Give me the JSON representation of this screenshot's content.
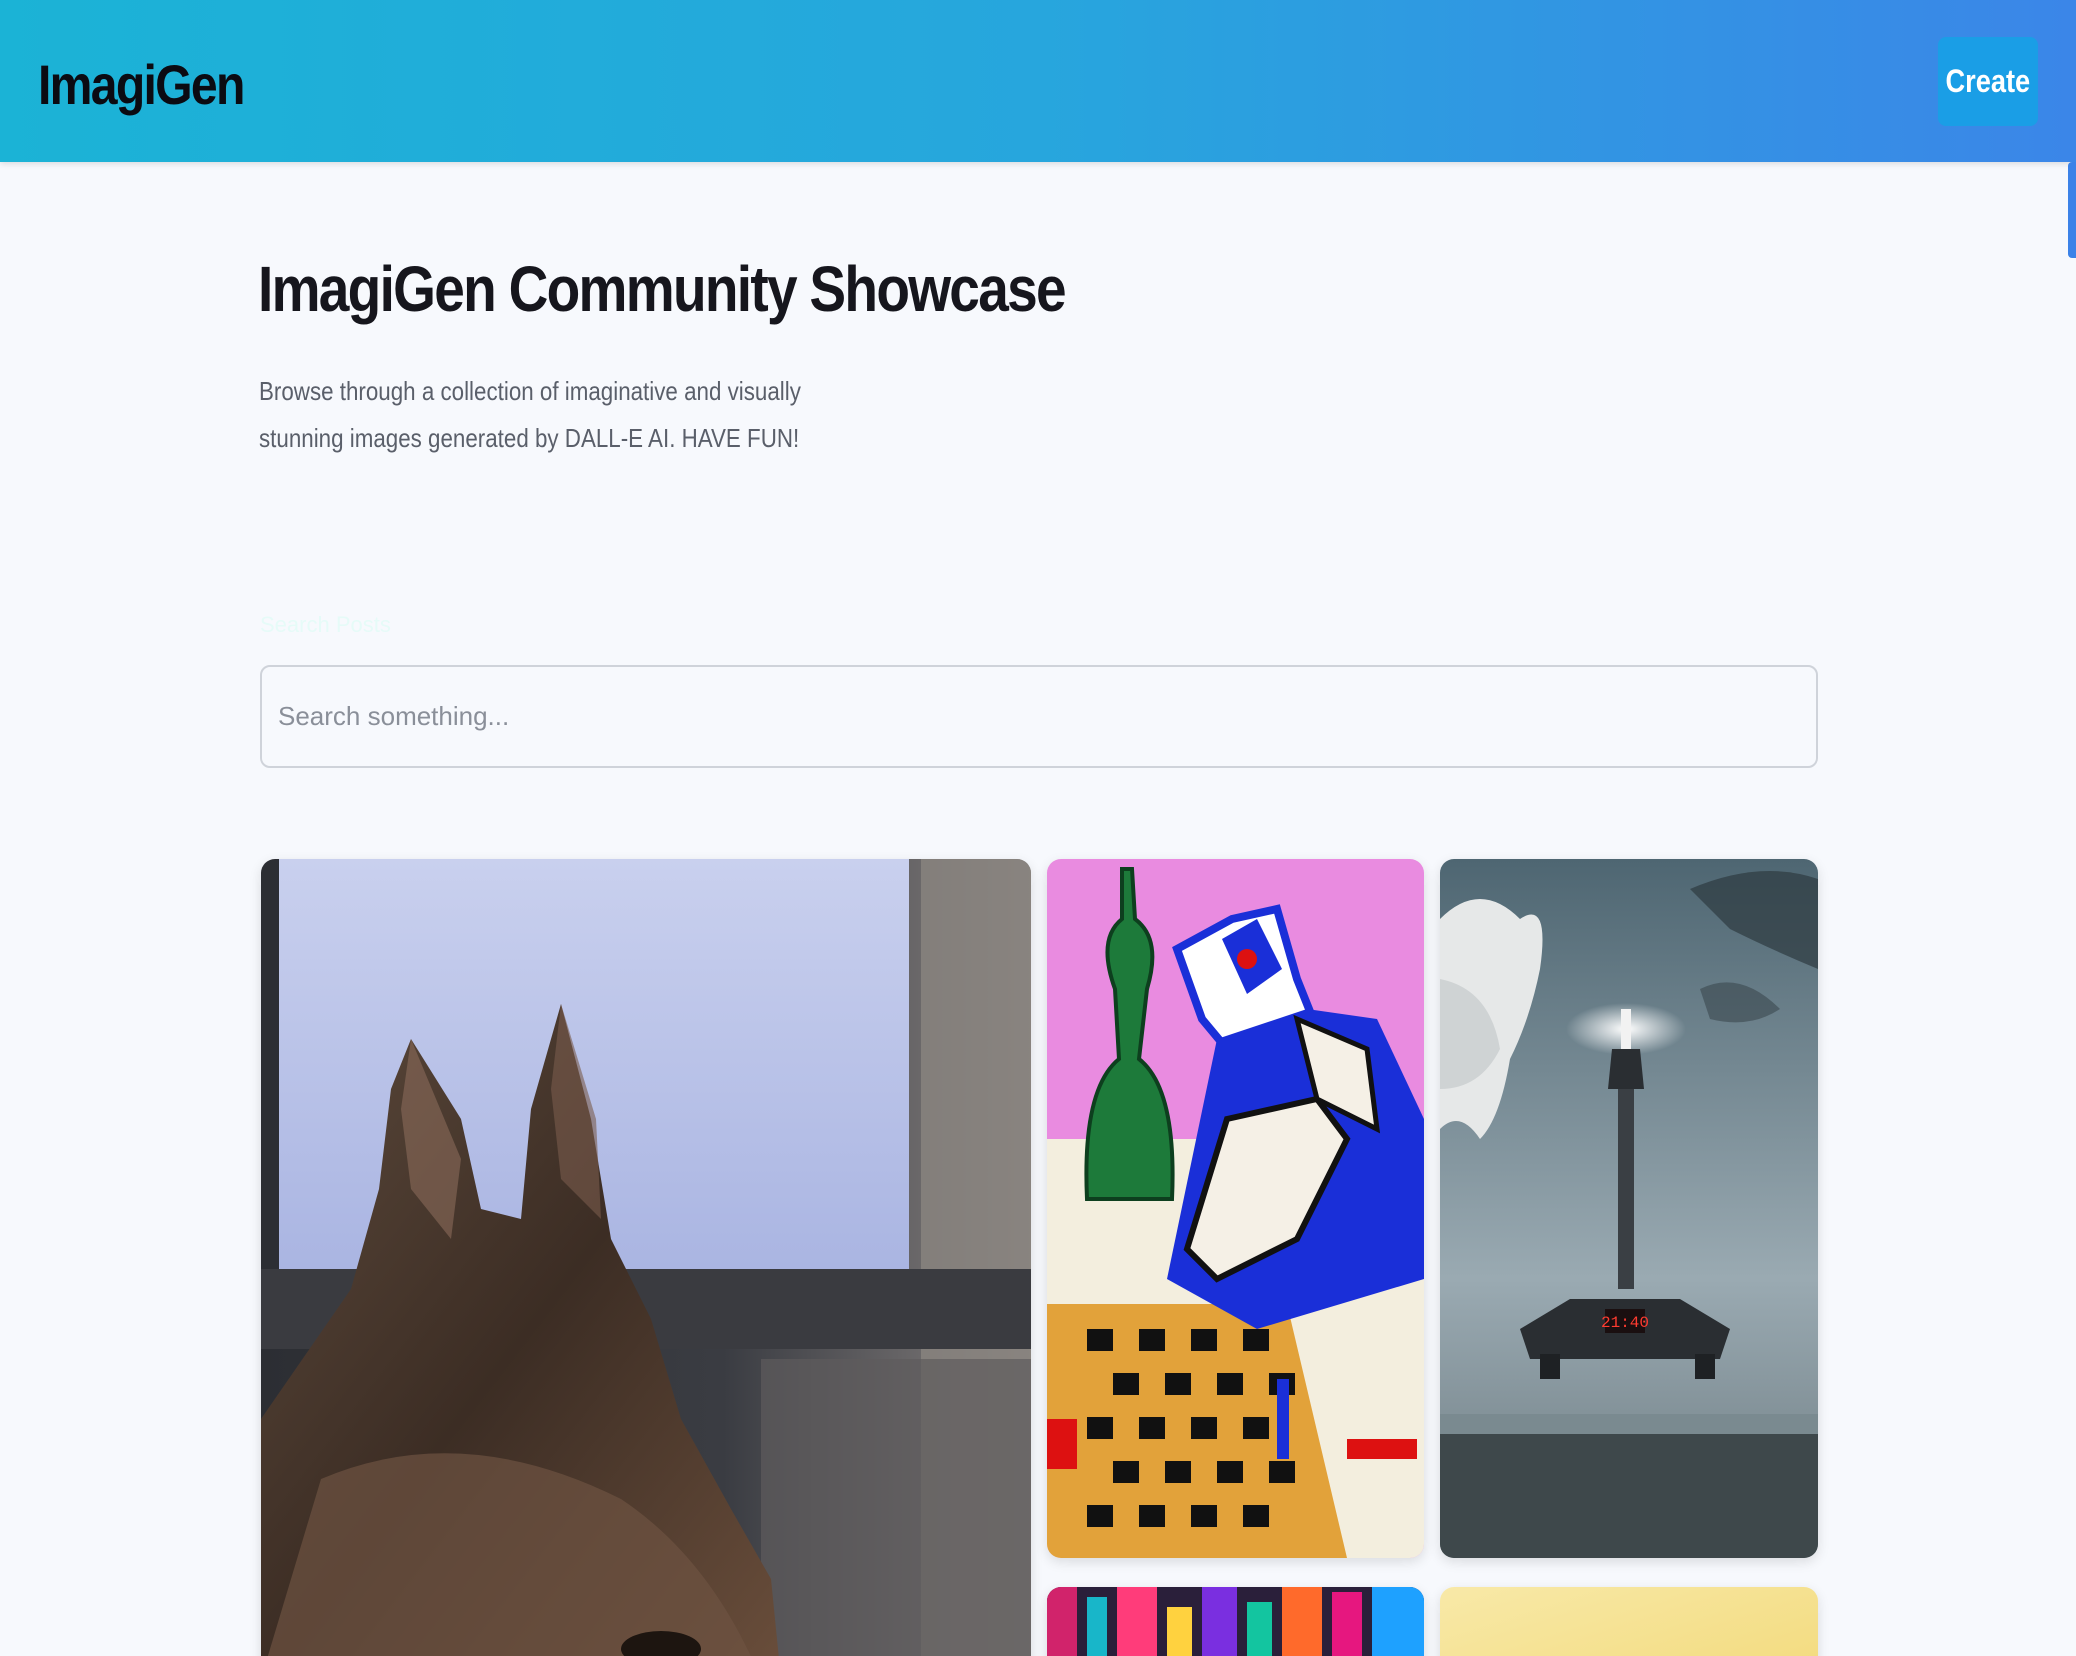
{
  "header": {
    "logo": "ImagiGen",
    "create_label": "Create",
    "gradient_colors": [
      "#1bb3d6",
      "#3b86e8"
    ],
    "button_color": "#1a9ee6"
  },
  "intro": {
    "title": "ImagiGen Community Showcase",
    "description": "Browse through a collection of imaginative and visually stunning images generated by DALL-E AI. HAVE FUN!"
  },
  "search": {
    "label": "Search Posts",
    "placeholder": "Search something..."
  },
  "gallery": {
    "cards": [
      {
        "subject": "dog near computer monitor photo"
      },
      {
        "subject": "cubist chess player painting"
      },
      {
        "subject": "floating tower with clock display above sea"
      },
      {
        "subject": "colorful city scene"
      },
      {
        "subject": "yellow abstract"
      }
    ]
  }
}
